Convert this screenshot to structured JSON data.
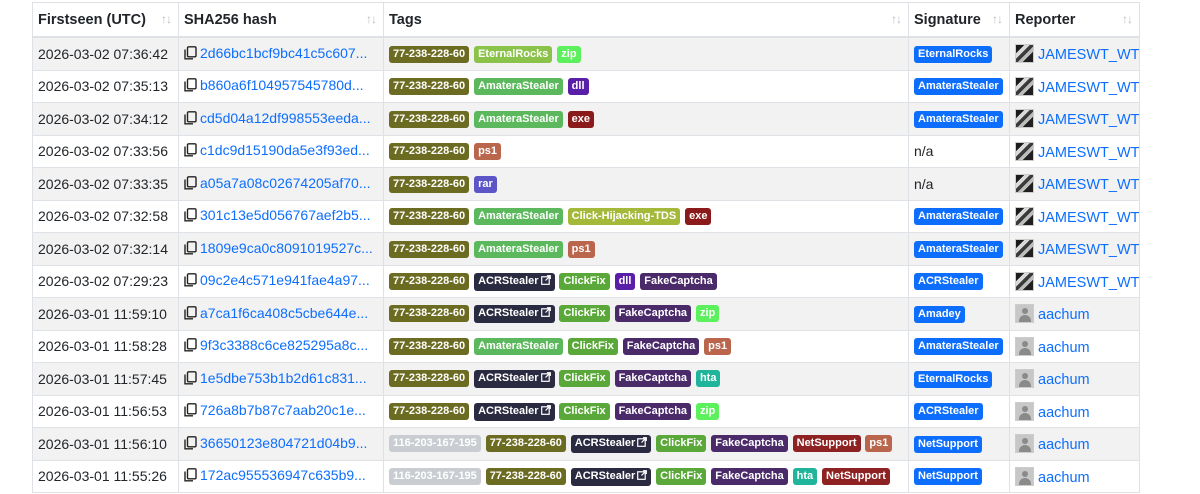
{
  "columns": [
    {
      "label": "Firstseen (UTC)"
    },
    {
      "label": "SHA256 hash"
    },
    {
      "label": "Tags"
    },
    {
      "label": "Signature"
    },
    {
      "label": "Reporter"
    }
  ],
  "tag_colors": {
    "77-238-228-60": "#6b6b21",
    "116-203-167-195": "#c9cdd1",
    "EternalRocks": "#8bc34a",
    "zip": "#5cf05c",
    "AmateraStealer": "#5cb85c",
    "dll": "#5a1fa8",
    "exe": "#8b1a1a",
    "ps1": "#b9664c",
    "rar": "#5b55c8",
    "Click-Hijacking-TDS": "#a4b83a",
    "ACRStealer": "#2a2a40",
    "ClickFix": "#5aa83a",
    "FakeCaptcha": "#4b2a6a",
    "hta": "#1fb59a",
    "NetSupport": "#8e2222"
  },
  "signature_color": "#0d6efd",
  "rows": [
    {
      "firstseen": "2026-03-02 07:36:42",
      "hash": "2d66bc1bcf9bc41c5c607...",
      "tags": [
        {
          "label": "77-238-228-60"
        },
        {
          "label": "EternalRocks"
        },
        {
          "label": "zip"
        }
      ],
      "signature": "EternalRocks",
      "reporter": "JAMESWT_WT",
      "avatar": "dark"
    },
    {
      "firstseen": "2026-03-02 07:35:13",
      "hash": "b860a6f104957545780d...",
      "tags": [
        {
          "label": "77-238-228-60"
        },
        {
          "label": "AmateraStealer"
        },
        {
          "label": "dll"
        }
      ],
      "signature": "AmateraStealer",
      "reporter": "JAMESWT_WT",
      "avatar": "dark"
    },
    {
      "firstseen": "2026-03-02 07:34:12",
      "hash": "cd5d04a12df998553eeda...",
      "tags": [
        {
          "label": "77-238-228-60"
        },
        {
          "label": "AmateraStealer"
        },
        {
          "label": "exe"
        }
      ],
      "signature": "AmateraStealer",
      "reporter": "JAMESWT_WT",
      "avatar": "dark"
    },
    {
      "firstseen": "2026-03-02 07:33:56",
      "hash": "c1dc9d15190da5e3f93ed...",
      "tags": [
        {
          "label": "77-238-228-60"
        },
        {
          "label": "ps1"
        }
      ],
      "signature": "n/a",
      "reporter": "JAMESWT_WT",
      "avatar": "dark"
    },
    {
      "firstseen": "2026-03-02 07:33:35",
      "hash": "a05a7a08c02674205af70...",
      "tags": [
        {
          "label": "77-238-228-60"
        },
        {
          "label": "rar"
        }
      ],
      "signature": "n/a",
      "reporter": "JAMESWT_WT",
      "avatar": "dark"
    },
    {
      "firstseen": "2026-03-02 07:32:58",
      "hash": "301c13e5d056767aef2b5...",
      "tags": [
        {
          "label": "77-238-228-60"
        },
        {
          "label": "AmateraStealer"
        },
        {
          "label": "Click-Hijacking-TDS"
        },
        {
          "label": "exe"
        }
      ],
      "signature": "AmateraStealer",
      "reporter": "JAMESWT_WT",
      "avatar": "dark"
    },
    {
      "firstseen": "2026-03-02 07:32:14",
      "hash": "1809e9ca0c8091019527c...",
      "tags": [
        {
          "label": "77-238-228-60"
        },
        {
          "label": "AmateraStealer"
        },
        {
          "label": "ps1"
        }
      ],
      "signature": "AmateraStealer",
      "reporter": "JAMESWT_WT",
      "avatar": "dark"
    },
    {
      "firstseen": "2026-03-02 07:29:23",
      "hash": "09c2e4c571e941fae4a97...",
      "tags": [
        {
          "label": "77-238-228-60"
        },
        {
          "label": "ACRStealer",
          "ext": true
        },
        {
          "label": "ClickFix"
        },
        {
          "label": "dll"
        },
        {
          "label": "FakeCaptcha"
        }
      ],
      "signature": "ACRStealer",
      "reporter": "JAMESWT_WT",
      "avatar": "dark"
    },
    {
      "firstseen": "2026-03-01 11:59:10",
      "hash": "a7ca1f6ca408c5cbe644e...",
      "tags": [
        {
          "label": "77-238-228-60"
        },
        {
          "label": "ACRStealer",
          "ext": true
        },
        {
          "label": "ClickFix"
        },
        {
          "label": "FakeCaptcha"
        },
        {
          "label": "zip"
        }
      ],
      "signature": "Amadey",
      "reporter": "aachum",
      "avatar": "grey"
    },
    {
      "firstseen": "2026-03-01 11:58:28",
      "hash": "9f3c3388c6ce825295a8c...",
      "tags": [
        {
          "label": "77-238-228-60"
        },
        {
          "label": "AmateraStealer"
        },
        {
          "label": "ClickFix"
        },
        {
          "label": "FakeCaptcha"
        },
        {
          "label": "ps1"
        }
      ],
      "signature": "AmateraStealer",
      "reporter": "aachum",
      "avatar": "grey"
    },
    {
      "firstseen": "2026-03-01 11:57:45",
      "hash": "1e5dbe753b1b2d61c831...",
      "tags": [
        {
          "label": "77-238-228-60"
        },
        {
          "label": "ACRStealer",
          "ext": true
        },
        {
          "label": "ClickFix"
        },
        {
          "label": "FakeCaptcha"
        },
        {
          "label": "hta"
        }
      ],
      "signature": "EternalRocks",
      "reporter": "aachum",
      "avatar": "grey"
    },
    {
      "firstseen": "2026-03-01 11:56:53",
      "hash": "726a8b7b87c7aab20c1e...",
      "tags": [
        {
          "label": "77-238-228-60"
        },
        {
          "label": "ACRStealer",
          "ext": true
        },
        {
          "label": "ClickFix"
        },
        {
          "label": "FakeCaptcha"
        },
        {
          "label": "zip"
        }
      ],
      "signature": "ACRStealer",
      "reporter": "aachum",
      "avatar": "grey"
    },
    {
      "firstseen": "2026-03-01 11:56:10",
      "hash": "36650123e804721d04b9...",
      "tags": [
        {
          "label": "116-203-167-195"
        },
        {
          "label": "77-238-228-60"
        },
        {
          "label": "ACRStealer",
          "ext": true
        },
        {
          "label": "ClickFix"
        },
        {
          "label": "FakeCaptcha"
        },
        {
          "label": "NetSupport"
        },
        {
          "label": "ps1"
        }
      ],
      "signature": "NetSupport",
      "reporter": "aachum",
      "avatar": "grey"
    },
    {
      "firstseen": "2026-03-01 11:55:26",
      "hash": "172ac955536947c635b9...",
      "tags": [
        {
          "label": "116-203-167-195"
        },
        {
          "label": "77-238-228-60"
        },
        {
          "label": "ACRStealer",
          "ext": true
        },
        {
          "label": "ClickFix"
        },
        {
          "label": "FakeCaptcha"
        },
        {
          "label": "hta"
        },
        {
          "label": "NetSupport"
        }
      ],
      "signature": "NetSupport",
      "reporter": "aachum",
      "avatar": "grey"
    }
  ]
}
